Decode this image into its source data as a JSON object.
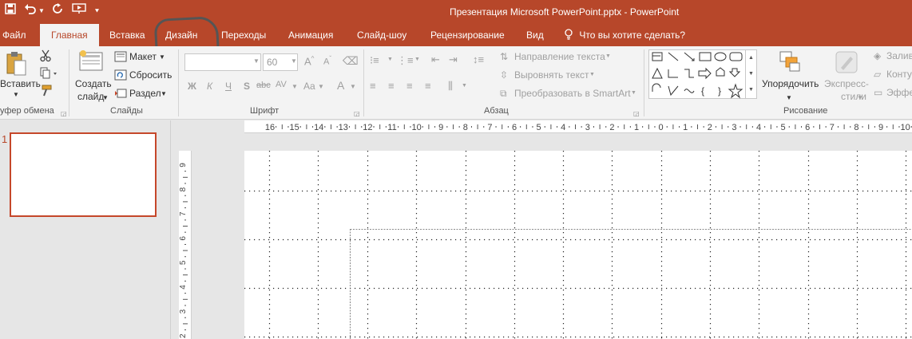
{
  "window": {
    "title": "Презентация Microsoft PowerPoint.pptx - PowerPoint"
  },
  "qat": {
    "icons": [
      "save-icon",
      "undo-icon",
      "undo-dropdown-icon",
      "redo-icon",
      "start-from-beginning-icon",
      "customize-qat-icon"
    ]
  },
  "tabs": [
    {
      "label": "Файл"
    },
    {
      "label": "Главная"
    },
    {
      "label": "Вставка"
    },
    {
      "label": "Дизайн"
    },
    {
      "label": "Переходы"
    },
    {
      "label": "Анимация"
    },
    {
      "label": "Слайд-шоу"
    },
    {
      "label": "Рецензирование"
    },
    {
      "label": "Вид"
    }
  ],
  "tell_me": "Что вы хотите сделать?",
  "ribbon": {
    "clipboard": {
      "paste_label": "Вставить",
      "group_label": "уфер обмена"
    },
    "slides": {
      "new_slide_line1": "Создать",
      "new_slide_line2": "слайд",
      "layout_label": "Макет",
      "reset_label": "Сбросить",
      "section_label": "Раздел",
      "group_label": "Слайды"
    },
    "font": {
      "font_name": "",
      "font_size": "60",
      "bold": "Ж",
      "italic": "К",
      "underline": "Ч",
      "shadow": "S",
      "strikethrough": "abc",
      "spacing": "AV",
      "case": "Aa",
      "color": "A",
      "group_label": "Шрифт"
    },
    "paragraph": {
      "text_direction": "Направление текста",
      "align_text": "Выровнять текст",
      "smartart": "Преобразовать в SmartArt",
      "group_label": "Абзац"
    },
    "drawing": {
      "arrange_label": "Упорядочить",
      "quick_styles_line1": "Экспресс-",
      "quick_styles_line2": "стили",
      "fill_label": "Залив",
      "outline_label": "Конту",
      "effects_label": "Эффе",
      "group_label": "Рисование"
    }
  },
  "thumbnails": [
    {
      "number": "1"
    }
  ],
  "ruler": {
    "horizontal": [
      "16",
      "15",
      "14",
      "13",
      "12",
      "11",
      "10",
      "9",
      "8",
      "7",
      "6",
      "5",
      "4",
      "3",
      "2",
      "1",
      "0",
      "1",
      "2",
      "3",
      "4",
      "5",
      "6",
      "7",
      "8",
      "9",
      "10"
    ],
    "vertical": [
      "9",
      "8",
      "7",
      "6",
      "5",
      "4",
      "3",
      "2"
    ]
  },
  "colors": {
    "accent": "#b7472a",
    "ribbon_bg": "#f3f3f3",
    "workspace_bg": "#e6e6e6"
  }
}
